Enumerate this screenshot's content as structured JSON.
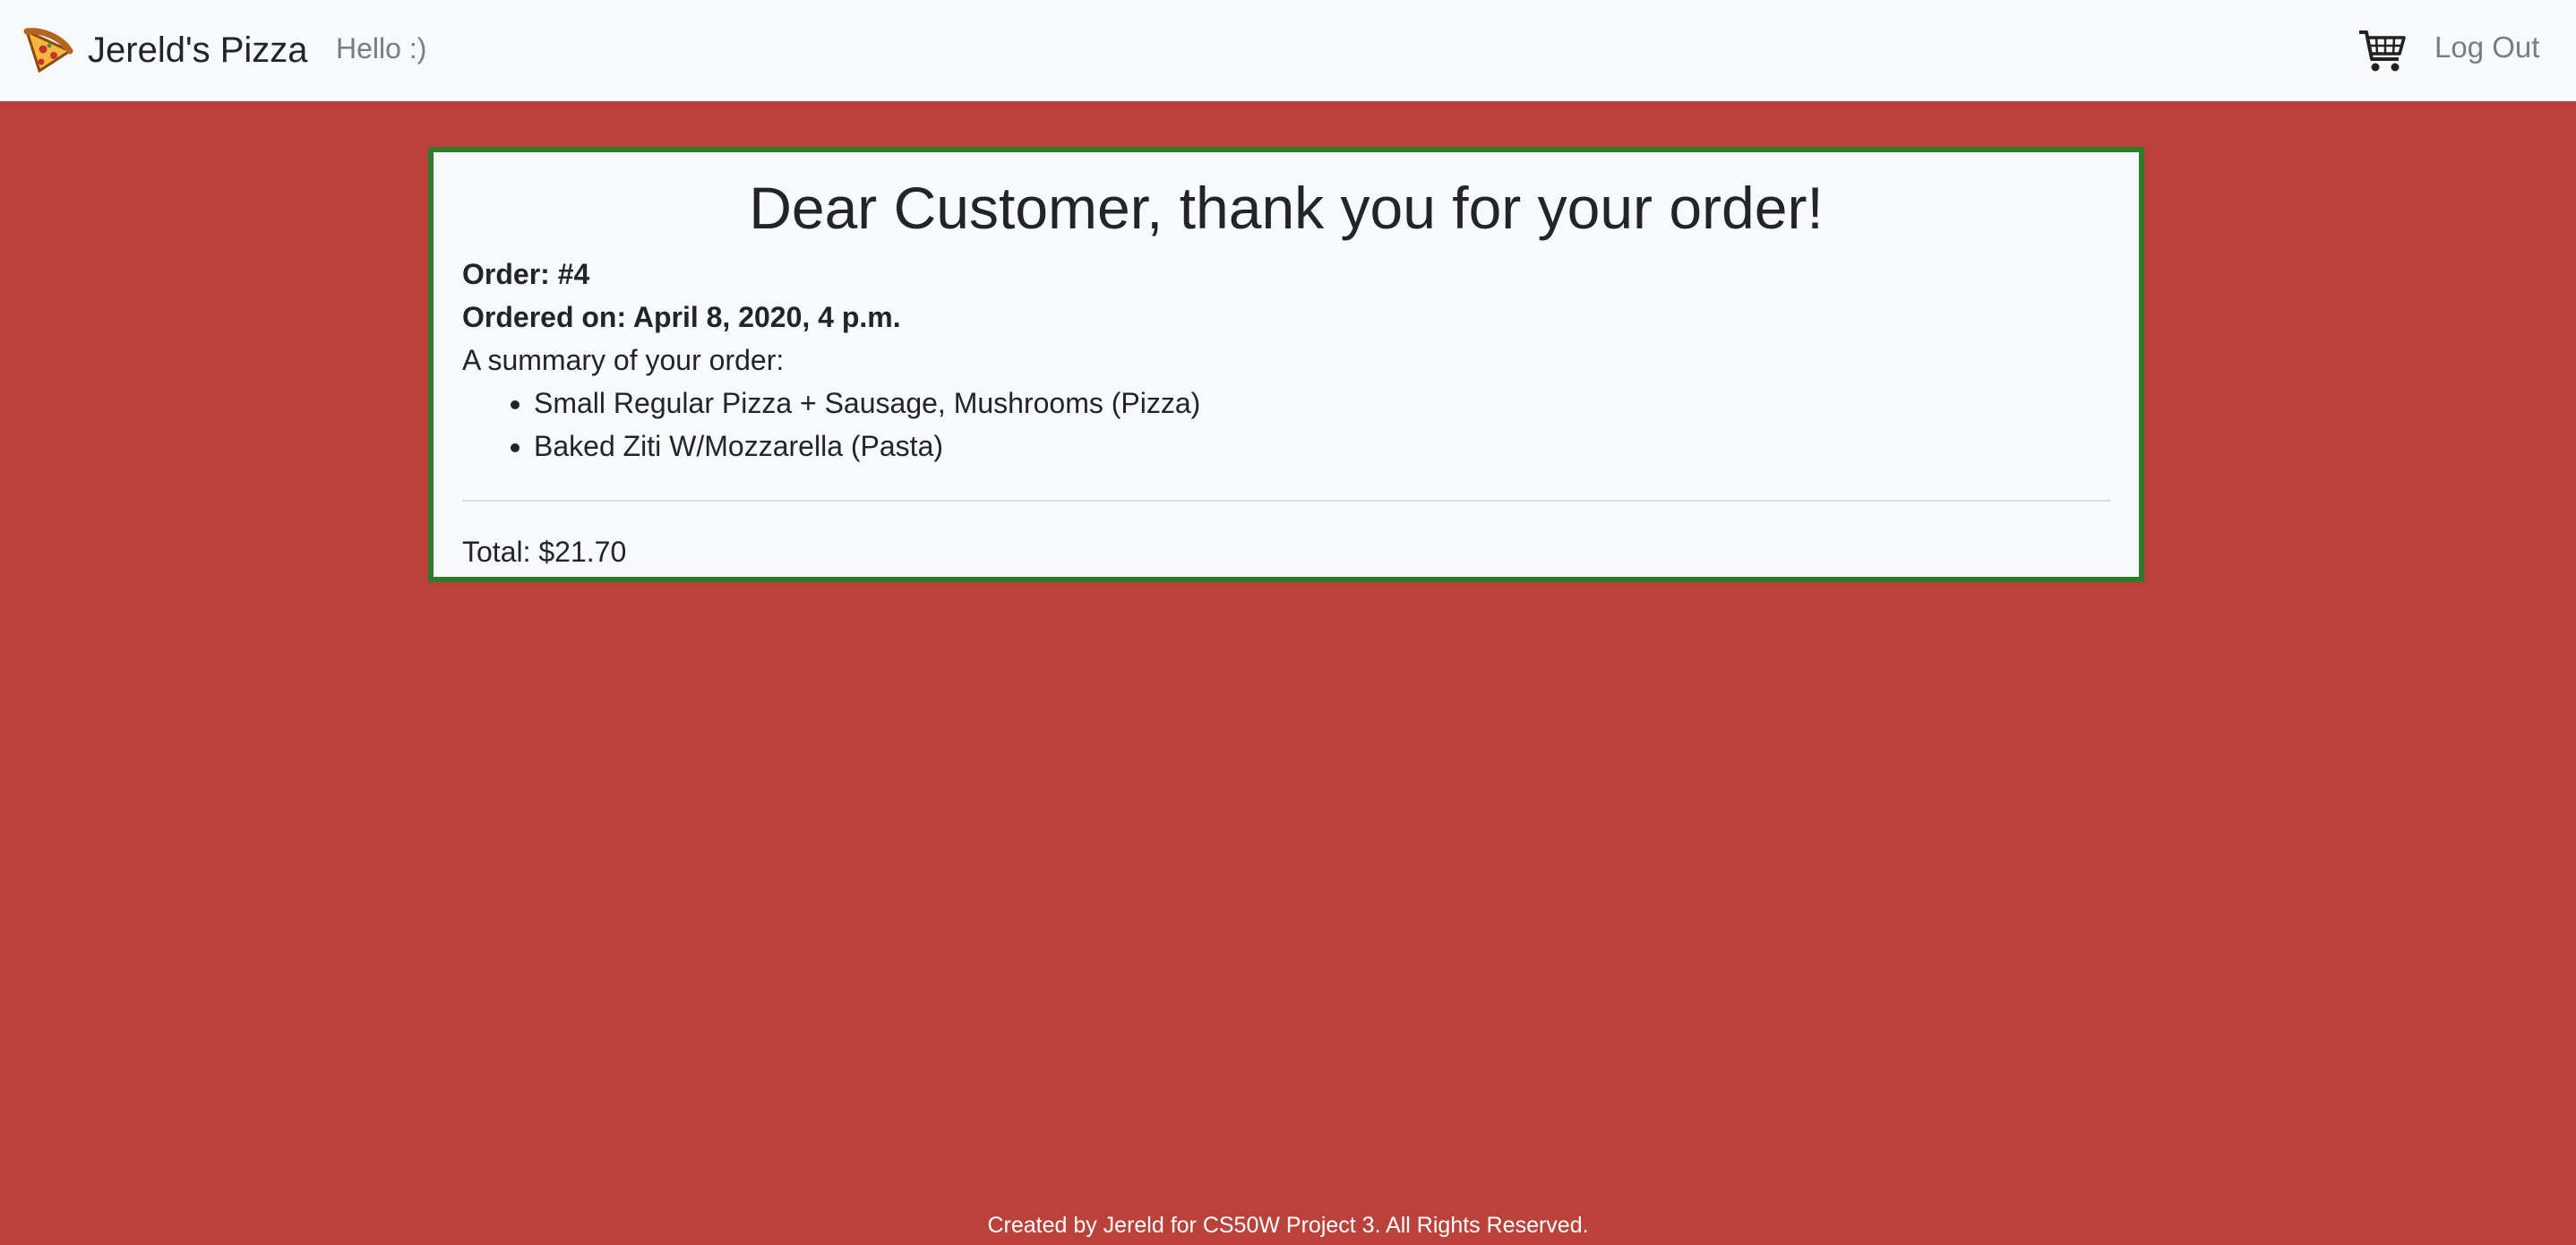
{
  "navbar": {
    "logo_icon": "pizza-slice-icon",
    "brand": "Jereld's Pizza",
    "greeting": "Hello :)",
    "cart_icon": "shopping-cart-icon",
    "logout": "Log Out"
  },
  "order": {
    "heading": "Dear Customer, thank you for your order!",
    "number": "Order: #4",
    "date": "Ordered on: April 8, 2020, 4 p.m.",
    "summary_label": "A summary of your order:",
    "items": [
      "Small Regular Pizza + Sausage, Mushrooms (Pizza)",
      "Baked Ziti W/Mozzarella (Pasta)"
    ],
    "total": "Total: $21.70"
  },
  "footer": {
    "text": "Created by Jereld for CS50W Project 3. All Rights Reserved."
  },
  "colors": {
    "page_background": "#bb423b",
    "navbar_background": "#f8f9fa",
    "card_border": "#2f7a2b",
    "card_background": "#f8f9fa"
  }
}
